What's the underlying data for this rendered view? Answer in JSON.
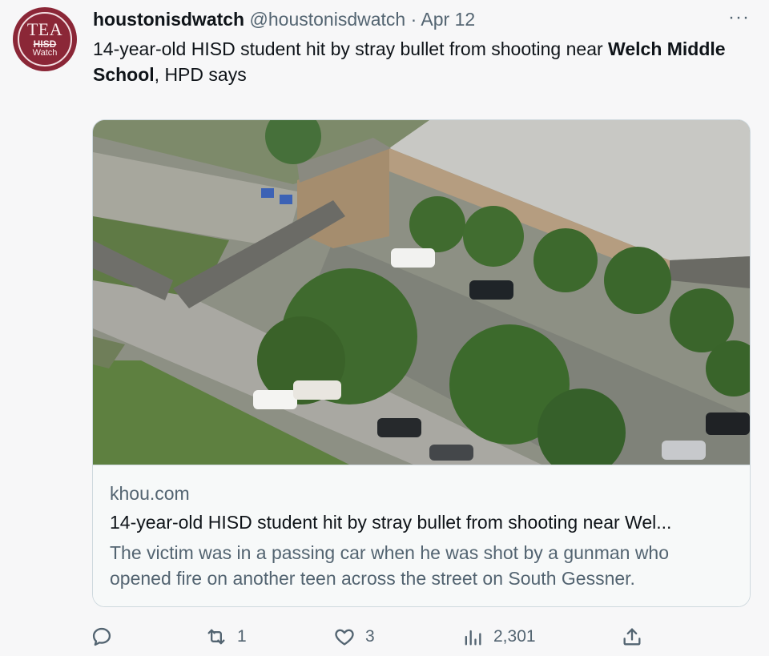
{
  "author": {
    "avatar_line1": "TEA",
    "avatar_line2": "HISD",
    "avatar_line3": "Watch",
    "display_name": "houstonisdwatch",
    "handle": "@houstonisdwatch",
    "separator": "·",
    "date": "Apr 12"
  },
  "more_label": "···",
  "tweet": {
    "text_part1": "14-year-old HISD student hit by stray bullet from shooting near ",
    "text_bold": "Welch Middle School",
    "text_part2": ", HPD says"
  },
  "card": {
    "domain": "khou.com",
    "title": "14-year-old HISD student hit by stray bullet from shooting near Wel...",
    "description": "The victim was in a passing car when he was shot by a gunman who opened fire on another teen across the street on South Gessner."
  },
  "actions": {
    "reply_count": "",
    "retweet_count": "1",
    "like_count": "3",
    "views_count": "2,301"
  },
  "colors": {
    "avatar_bg": "#8b2737",
    "text_primary": "#0f1419",
    "text_secondary": "#536471",
    "border": "#cfd9de"
  }
}
